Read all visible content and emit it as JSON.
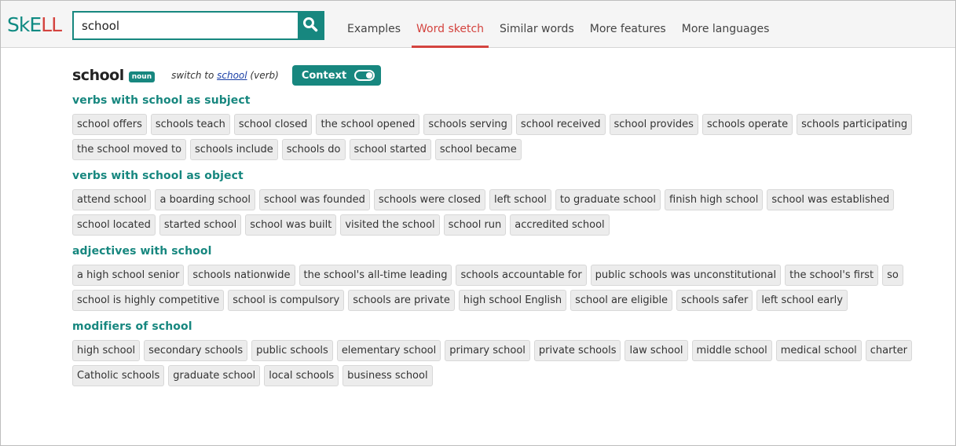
{
  "logo": {
    "part1": "SkE",
    "part2": "LL"
  },
  "search": {
    "value": "school",
    "placeholder": ""
  },
  "nav": {
    "items": [
      {
        "label": "Examples",
        "active": false
      },
      {
        "label": "Word sketch",
        "active": true
      },
      {
        "label": "Similar words",
        "active": false
      },
      {
        "label": "More features",
        "active": false
      },
      {
        "label": "More languages",
        "active": false
      }
    ]
  },
  "header": {
    "headword": "school",
    "pos": "noun",
    "switch_prefix": "switch to ",
    "switch_link": "school",
    "switch_suffix": " (verb)",
    "context_label": "Context"
  },
  "sections": [
    {
      "title": "verbs with school as subject",
      "rows": [
        [
          "school offers",
          "schools teach",
          "school closed",
          "the school opened",
          "schools serving",
          "school received",
          "school provides",
          "schools operate",
          "schools participating"
        ],
        [
          "the school moved to",
          "schools include",
          "schools do",
          "school started",
          "school became"
        ]
      ]
    },
    {
      "title": "verbs with school as object",
      "rows": [
        [
          "attend school",
          "a boarding school",
          "school was founded",
          "schools were closed",
          "left school",
          "to graduate school",
          "finish high school",
          "school was established"
        ],
        [
          "school located",
          "started school",
          "school was built",
          "visited the school",
          "school run",
          "accredited school"
        ]
      ]
    },
    {
      "title": "adjectives with school",
      "rows": [
        [
          "a high school senior",
          "schools nationwide",
          "the school's all-time leading",
          "schools accountable for",
          "public schools was unconstitutional",
          "the school's first",
          "so"
        ],
        [
          "school is highly competitive",
          "school is compulsory",
          "schools are private",
          "high school English",
          "school are eligible",
          "schools safer",
          "left school early"
        ]
      ]
    },
    {
      "title": "modifiers of school",
      "rows": [
        [
          "high school",
          "secondary schools",
          "public schools",
          "elementary school",
          "primary school",
          "private schools",
          "law school",
          "middle school",
          "medical school",
          "charter"
        ],
        [
          "Catholic schools",
          "graduate school",
          "local schools",
          "business school"
        ]
      ]
    }
  ],
  "colors": {
    "accent": "#17877f",
    "active_nav": "#d4443f",
    "chip_bg": "#ececec"
  }
}
